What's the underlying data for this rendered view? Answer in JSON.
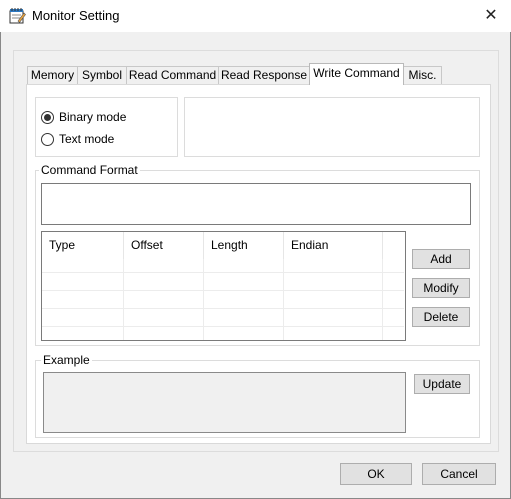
{
  "window": {
    "title": "Monitor Setting",
    "close_glyph": "✕"
  },
  "tabs": [
    {
      "label": "Memory"
    },
    {
      "label": "Symbol"
    },
    {
      "label": "Read Command"
    },
    {
      "label": "Read Response"
    },
    {
      "label": "Write Command"
    },
    {
      "label": "Misc."
    }
  ],
  "mode": {
    "binary_label": "Binary mode",
    "text_label": "Text mode",
    "selected": "Binary mode"
  },
  "command_format": {
    "group_label": "Command Format",
    "format_value": "",
    "columns": [
      "Type",
      "Offset",
      "Length",
      "Endian"
    ],
    "rows": []
  },
  "buttons": {
    "add": "Add",
    "modify": "Modify",
    "delete": "Delete",
    "update": "Update",
    "ok": "OK",
    "cancel": "Cancel"
  },
  "example": {
    "group_label": "Example",
    "value": ""
  }
}
